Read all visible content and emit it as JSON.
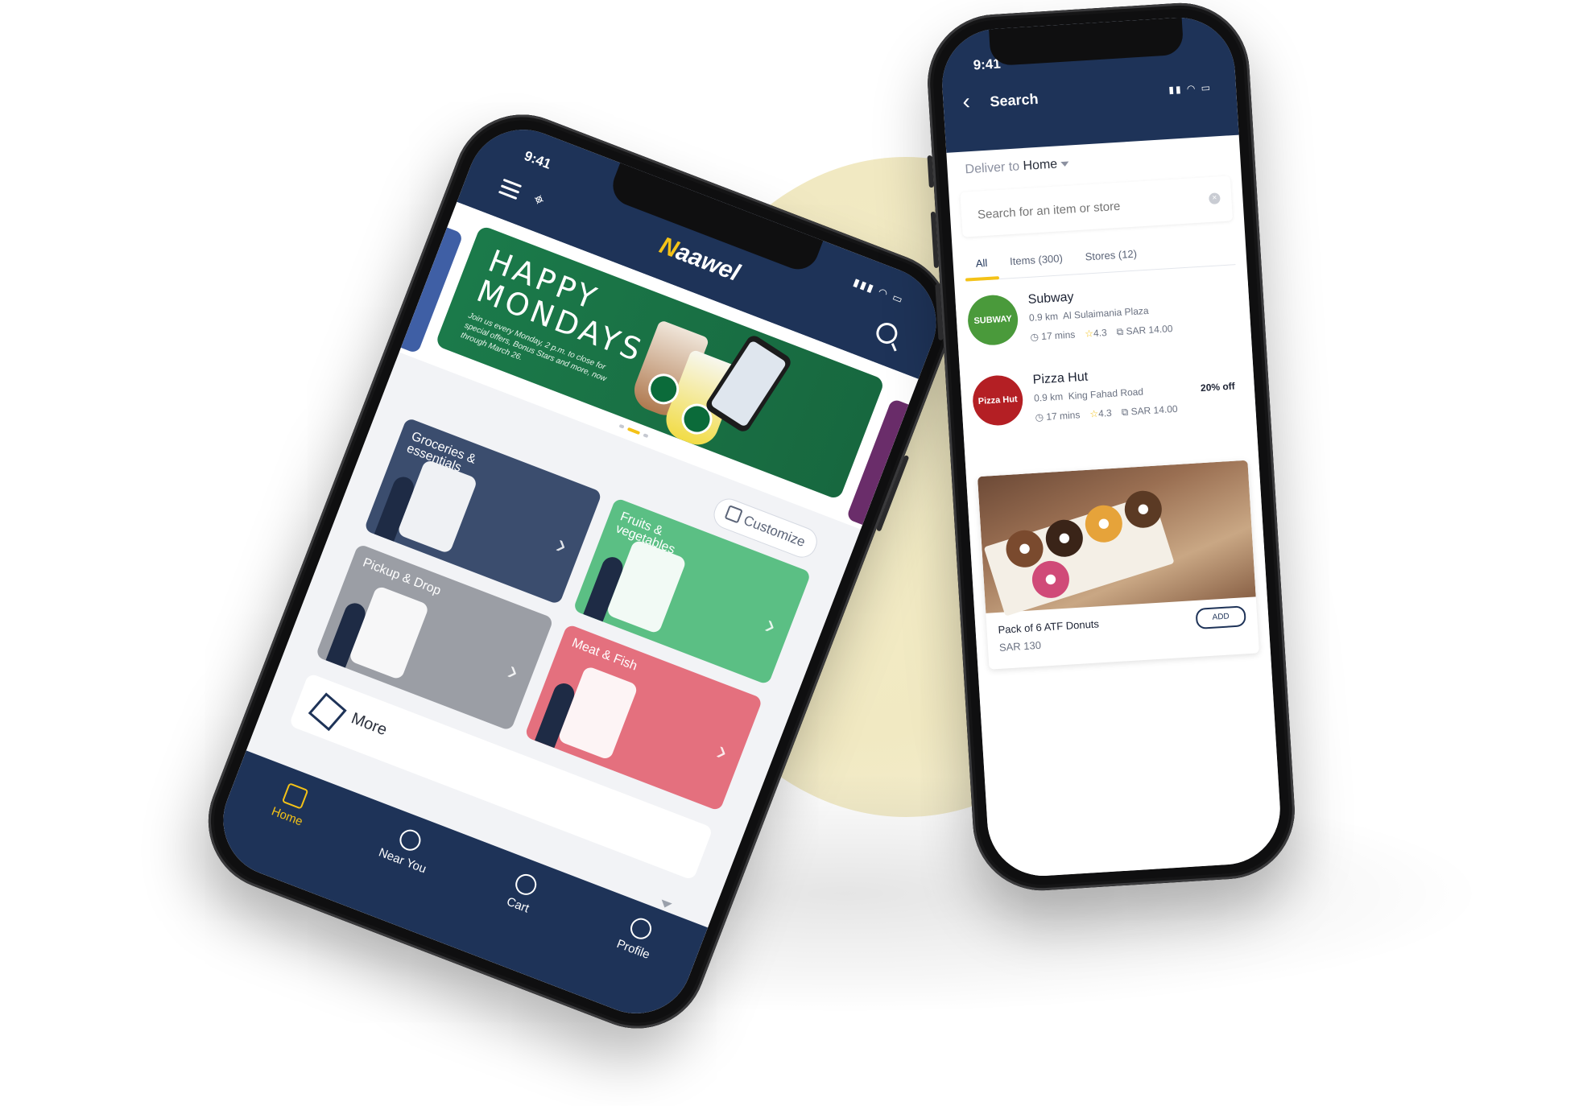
{
  "left_phone": {
    "status": {
      "time": "9:41"
    },
    "header": {
      "logo": "aawel",
      "menu_icon": "menu-icon",
      "location_icon": "location-pin-icon",
      "search_icon": "search-icon"
    },
    "banner": {
      "title_line1": "HAPPY",
      "title_line2": "MONDAYS",
      "subtitle": "Join us every Monday, 2 p.m. to close for special offers, Bonus Stars and more, now through March 26."
    },
    "customize_label": "Customize",
    "categories": [
      {
        "label": "Groceries & essentials",
        "color": "#3b4d6e"
      },
      {
        "label": "Fruits & vegetables",
        "color": "#5bbf84"
      },
      {
        "label": "Pickup & Drop",
        "color": "#9b9ea5"
      },
      {
        "label": "Meat & Fish",
        "color": "#e4707e"
      }
    ],
    "more_label": "More",
    "nav": [
      {
        "label": "Home",
        "icon": "home-icon",
        "active": true
      },
      {
        "label": "Near You",
        "icon": "location-pin-icon",
        "active": false
      },
      {
        "label": "Cart",
        "icon": "cart-icon",
        "active": false
      },
      {
        "label": "Profile",
        "icon": "user-icon",
        "active": false
      }
    ]
  },
  "right_phone": {
    "status": {
      "time": "9:41"
    },
    "header": {
      "title": "Search",
      "back_icon": "back-icon"
    },
    "deliver_to": {
      "prefix": "Deliver to",
      "value": "Home"
    },
    "search": {
      "placeholder": "Search for an item or store",
      "clear_icon": "clear-icon"
    },
    "tabs": [
      {
        "label": "All",
        "active": true
      },
      {
        "label": "Items (300)",
        "active": false
      },
      {
        "label": "Stores (12)",
        "active": false
      }
    ],
    "stores": [
      {
        "name": "Subway",
        "logo_text": "SUBWAY",
        "logo_color": "#4a9a3b",
        "distance": "0.9 km",
        "location": "Al Sulaimania Plaza",
        "time": "17 mins",
        "rating": "4.3",
        "fee": "SAR 14.00",
        "offer": ""
      },
      {
        "name": "Pizza Hut",
        "logo_text": "Pizza Hut",
        "logo_color": "#b41f24",
        "distance": "0.9 km",
        "location": "King Fahad Road",
        "time": "17 mins",
        "rating": "4.3",
        "fee": "SAR 14.00",
        "offer": "20% off"
      }
    ],
    "product": {
      "name": "Pack of 6 ATF Donuts",
      "price": "SAR 130",
      "add_label": "ADD"
    }
  },
  "colors": {
    "navy": "#1e3358",
    "accent": "#f4c217"
  }
}
